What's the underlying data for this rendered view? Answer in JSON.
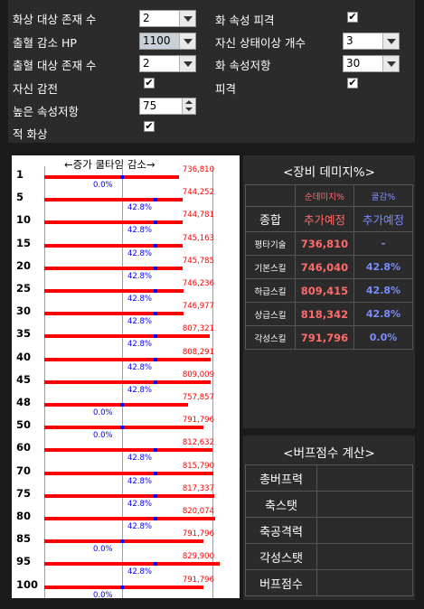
{
  "settings": {
    "burn_target_count": {
      "label": "화상 대상 존재 수",
      "value": "2"
    },
    "bleed_hp_decrease": {
      "label": "출혈 감소 HP",
      "value": "1100"
    },
    "bleed_target_count": {
      "label": "출혈 대상 존재 수",
      "value": "2"
    },
    "self_sense": {
      "label": "자신 감전"
    },
    "high_attr_reduce": {
      "label": "높은 속성저항",
      "value": "75"
    },
    "enemy_burn": {
      "label": "적 화상"
    },
    "fire_attr_hit": {
      "label": "화 속성 피격"
    },
    "self_abnormal_count": {
      "label": "자신 상태이상 개수",
      "value": "3"
    },
    "fire_attr_reduce": {
      "label": "화 속성저항",
      "value": "30"
    },
    "hit": {
      "label": "피격"
    },
    "check_mark": "✔"
  },
  "chart": {
    "title": "←증가  쿨타임  감소→",
    "rows": [
      {
        "level": "1",
        "value": "736,810",
        "pct": "0.0%",
        "v": 736810,
        "p": 0.0
      },
      {
        "level": "5",
        "value": "744,252",
        "pct": "42.8%",
        "v": 744252,
        "p": 42.8
      },
      {
        "level": "10",
        "value": "744,781",
        "pct": "42.8%",
        "v": 744781,
        "p": 42.8
      },
      {
        "level": "15",
        "value": "745,163",
        "pct": "42.8%",
        "v": 745163,
        "p": 42.8
      },
      {
        "level": "20",
        "value": "745,785",
        "pct": "42.8%",
        "v": 745785,
        "p": 42.8
      },
      {
        "level": "25",
        "value": "746,236",
        "pct": "42.8%",
        "v": 746236,
        "p": 42.8
      },
      {
        "level": "30",
        "value": "746,977",
        "pct": "42.8%",
        "v": 746977,
        "p": 42.8
      },
      {
        "level": "35",
        "value": "807,321",
        "pct": "42.8%",
        "v": 807321,
        "p": 42.8
      },
      {
        "level": "40",
        "value": "808,291",
        "pct": "42.8%",
        "v": 808291,
        "p": 42.8
      },
      {
        "level": "45",
        "value": "809,009",
        "pct": "42.8%",
        "v": 809009,
        "p": 42.8
      },
      {
        "level": "48",
        "value": "757,857",
        "pct": "0.0%",
        "v": 757857,
        "p": 0.0
      },
      {
        "level": "50",
        "value": "791,796",
        "pct": "0.0%",
        "v": 791796,
        "p": 0.0
      },
      {
        "level": "60",
        "value": "812,632",
        "pct": "42.8%",
        "v": 812632,
        "p": 42.8
      },
      {
        "level": "70",
        "value": "815,790",
        "pct": "42.8%",
        "v": 815790,
        "p": 42.8
      },
      {
        "level": "75",
        "value": "817,337",
        "pct": "42.8%",
        "v": 817337,
        "p": 42.8
      },
      {
        "level": "80",
        "value": "820,074",
        "pct": "42.8%",
        "v": 820074,
        "p": 42.8
      },
      {
        "level": "85",
        "value": "791,796",
        "pct": "0.0%",
        "v": 791796,
        "p": 0.0
      },
      {
        "level": "95",
        "value": "829,900",
        "pct": "42.8%",
        "v": 829900,
        "p": 42.8
      },
      {
        "level": "100",
        "value": "791,796",
        "pct": "0.0%",
        "v": 791796,
        "p": 0.0
      }
    ]
  },
  "equip": {
    "title": "<장비 데미지%>",
    "col_damage": "순데미지%",
    "col_cool": "쿨감%",
    "row_total": "종합",
    "add_expected_1": "추가예정",
    "add_expected_2": "추가예정",
    "rows": [
      {
        "name": "평타기술",
        "damage": "736,810",
        "cool": "-"
      },
      {
        "name": "기본스킬",
        "damage": "746,040",
        "cool": "42.8%"
      },
      {
        "name": "하급스킬",
        "damage": "809,415",
        "cool": "42.8%"
      },
      {
        "name": "상급스킬",
        "damage": "818,342",
        "cool": "42.8%"
      },
      {
        "name": "각성스킬",
        "damage": "791,796",
        "cool": "0.0%"
      }
    ]
  },
  "buff": {
    "title": "<버프점수 계산>",
    "rows": [
      "총버프력",
      "축스탯",
      "축공격력",
      "각성스탯",
      "버프점수"
    ]
  },
  "colors": {
    "bar": "#ff0000",
    "cool": "#0000ff",
    "damage_text": "#ff6a6a",
    "cool_text": "#7b8cff"
  }
}
